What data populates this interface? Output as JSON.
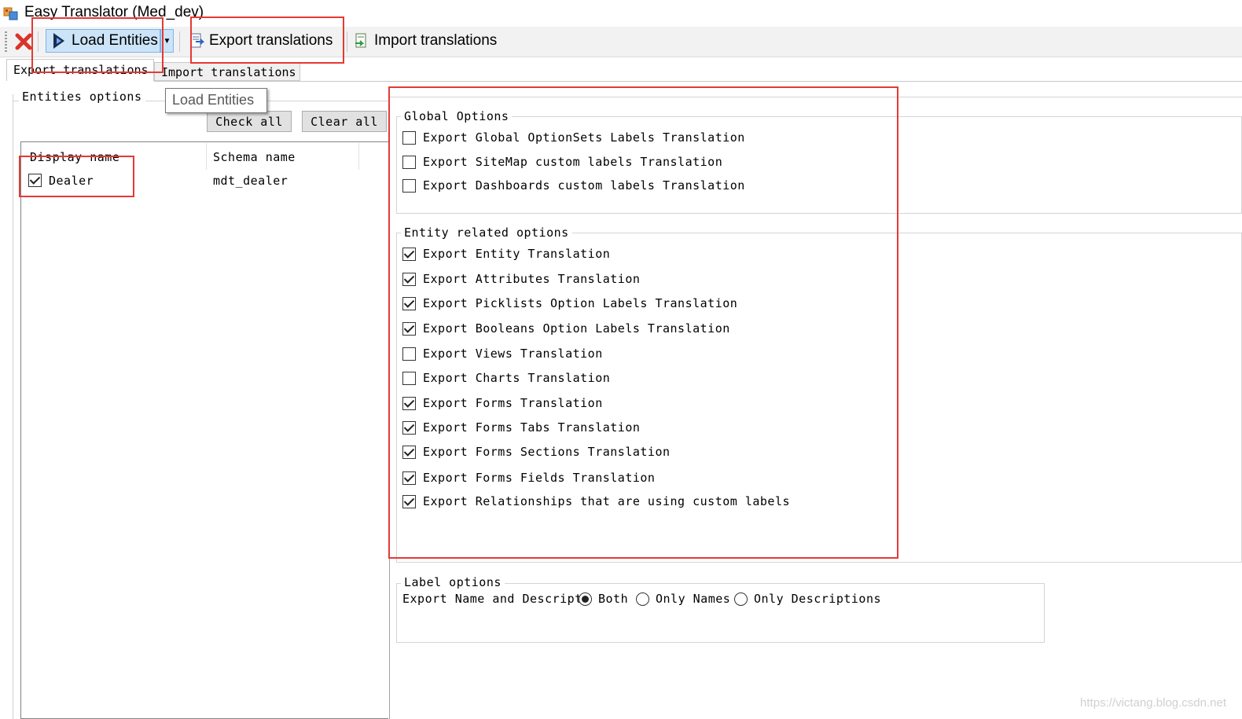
{
  "window": {
    "title": "Easy Translator (Med_dev)"
  },
  "toolbar": {
    "close_icon": "red-x-icon",
    "load_entities_label": "Load Entities",
    "export_translations_label": "Export translations",
    "import_translations_label": "Import translations"
  },
  "tabs": [
    {
      "label": "Export translations",
      "active": true
    },
    {
      "label": "Import translations",
      "active": false
    }
  ],
  "tooltip": {
    "text": "Load Entities"
  },
  "entities_options": {
    "legend": "Entities options",
    "check_all_label": "Check all",
    "clear_all_label": "Clear all",
    "columns": [
      "Display name",
      "Schema name"
    ],
    "rows": [
      {
        "display_name": "Dealer",
        "schema_name": "mdt_dealer",
        "checked": true
      }
    ]
  },
  "global_options": {
    "legend": "Global Options",
    "items": [
      {
        "label": "Export Global OptionSets Labels Translation",
        "checked": false
      },
      {
        "label": "Export SiteMap custom labels Translation",
        "checked": false
      },
      {
        "label": "Export Dashboards custom labels Translation",
        "checked": false
      }
    ]
  },
  "entity_options": {
    "legend": "Entity related options",
    "items": [
      {
        "label": "Export Entity Translation",
        "checked": true
      },
      {
        "label": "Export Attributes Translation",
        "checked": true
      },
      {
        "label": "Export Picklists Option Labels Translation",
        "checked": true
      },
      {
        "label": "Export Booleans Option Labels Translation",
        "checked": true
      },
      {
        "label": "Export Views Translation",
        "checked": false
      },
      {
        "label": "Export Charts Translation",
        "checked": false
      },
      {
        "label": "Export Forms Translation",
        "checked": true
      },
      {
        "label": "Export Forms Tabs Translation",
        "checked": true
      },
      {
        "label": "Export Forms Sections Translation",
        "checked": true
      },
      {
        "label": "Export Forms Fields Translation",
        "checked": true
      },
      {
        "label": "Export Relationships that are using custom labels",
        "checked": true
      }
    ]
  },
  "label_options": {
    "legend": "Label options",
    "field_label": "Export Name and Descripti",
    "radios": [
      {
        "label": "Both",
        "selected": true
      },
      {
        "label": "Only Names",
        "selected": false
      },
      {
        "label": "Only Descriptions",
        "selected": false
      }
    ]
  },
  "watermark": "https://victang.blog.csdn.net",
  "colors": {
    "highlight": "#e53935",
    "selected_button": "#cce4f7"
  }
}
